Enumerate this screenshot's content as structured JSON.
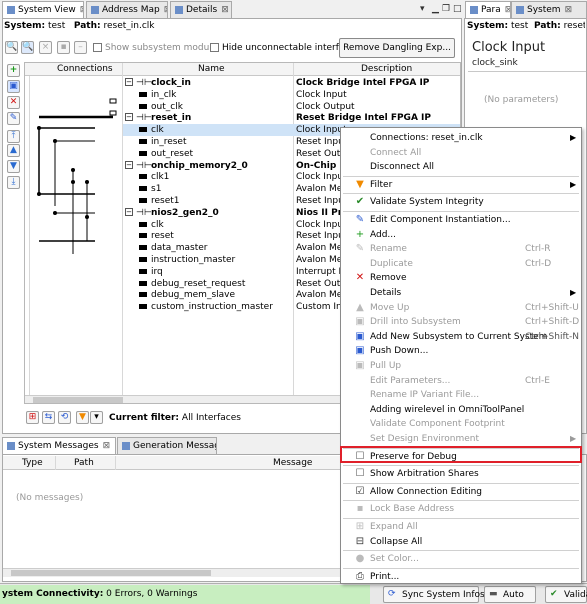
{
  "system_view": {
    "tabs": [
      {
        "label": "System View",
        "active": true
      },
      {
        "label": "Address Map",
        "active": false
      },
      {
        "label": "Details",
        "active": false
      }
    ],
    "system_label": "System:",
    "system_value": "test",
    "path_label": "Path:",
    "path_value": "reset_in.clk",
    "show_subsystem_label": "Show subsystem modu...",
    "hide_unconnectable_label": "Hide unconnectable interfa...",
    "remove_dangling_label": "Remove Dangling Exp...",
    "columns": [
      "Connections",
      "Name",
      "Description"
    ],
    "rows": [
      {
        "name": "clock_in",
        "desc": "Clock Bridge Intel FPGA IP",
        "bold": true,
        "level": 0
      },
      {
        "name": "in_clk",
        "desc": "Clock Input",
        "bold": false,
        "level": 1
      },
      {
        "name": "out_clk",
        "desc": "Clock Output",
        "bold": false,
        "level": 1
      },
      {
        "name": "reset_in",
        "desc": "Reset Bridge Intel FPGA IP",
        "bold": true,
        "level": 0
      },
      {
        "name": "clk",
        "desc": "Clock Input",
        "bold": false,
        "level": 1,
        "selected": true
      },
      {
        "name": "in_reset",
        "desc": "Reset Input",
        "bold": false,
        "level": 1
      },
      {
        "name": "out_reset",
        "desc": "Reset Output",
        "bold": false,
        "level": 1
      },
      {
        "name": "onchip_memory2_0",
        "desc": "On-Chip Me",
        "bold": true,
        "level": 0
      },
      {
        "name": "clk1",
        "desc": "Clock Input",
        "bold": false,
        "level": 1
      },
      {
        "name": "s1",
        "desc": "Avalon Mem",
        "bold": false,
        "level": 1
      },
      {
        "name": "reset1",
        "desc": "Reset Input",
        "bold": false,
        "level": 1
      },
      {
        "name": "nios2_gen2_0",
        "desc": "Nios II Pro",
        "bold": true,
        "level": 0
      },
      {
        "name": "clk",
        "desc": "Clock Input",
        "bold": false,
        "level": 1
      },
      {
        "name": "reset",
        "desc": "Reset Input",
        "bold": false,
        "level": 1
      },
      {
        "name": "data_master",
        "desc": "Avalon Mem",
        "bold": false,
        "level": 1
      },
      {
        "name": "instruction_master",
        "desc": "Avalon Mem",
        "bold": false,
        "level": 1
      },
      {
        "name": "irq",
        "desc": "Interrupt Re",
        "bold": false,
        "level": 1
      },
      {
        "name": "debug_reset_request",
        "desc": "Reset Outpu",
        "bold": false,
        "level": 1
      },
      {
        "name": "debug_mem_slave",
        "desc": "Avalon Mem",
        "bold": false,
        "level": 1
      },
      {
        "name": "custom_instruction_master",
        "desc": "Custom Inst",
        "bold": false,
        "level": 1
      }
    ],
    "filter_label": "Current filter:",
    "filter_value": "All Interfaces"
  },
  "params": {
    "tabs": [
      {
        "label": "Para",
        "active": true
      },
      {
        "label": "System",
        "active": false
      }
    ],
    "system_label": "System:",
    "system_value": "test",
    "path_label": "Path:",
    "path_value": "reset_",
    "title": "Clock Input",
    "subtitle": "clock_sink",
    "empty": "(No parameters)"
  },
  "messages": {
    "tabs": [
      {
        "label": "System Messages",
        "active": true
      },
      {
        "label": "Generation Messages",
        "active": false
      }
    ],
    "columns": [
      "Type",
      "Path",
      "Message"
    ],
    "empty": "(No messages)"
  },
  "context_menu": {
    "items": [
      {
        "label": "Connections: reset_in.clk",
        "arrow": true,
        "enabled": true,
        "icon": ""
      },
      {
        "label": "Connect All",
        "enabled": false,
        "icon": ""
      },
      {
        "label": "Disconnect All",
        "enabled": true,
        "icon": ""
      },
      {
        "sep": true
      },
      {
        "label": "Filter",
        "arrow": true,
        "enabled": true,
        "icon": "filter-icon"
      },
      {
        "sep": true
      },
      {
        "label": "Validate System Integrity",
        "enabled": true,
        "icon": "validate-icon"
      },
      {
        "sep": true
      },
      {
        "label": "Edit Component Instantiation...",
        "enabled": true,
        "icon": "edit-icon"
      },
      {
        "label": "Add...",
        "enabled": true,
        "icon": "add-icon"
      },
      {
        "label": "Rename",
        "shortcut": "Ctrl-R",
        "enabled": false,
        "icon": "rename-icon"
      },
      {
        "label": "Duplicate",
        "shortcut": "Ctrl-D",
        "enabled": false,
        "icon": ""
      },
      {
        "label": "Remove",
        "enabled": true,
        "icon": "remove-icon"
      },
      {
        "label": "Details",
        "arrow": true,
        "enabled": true,
        "icon": ""
      },
      {
        "label": "Move Up",
        "shortcut": "Ctrl+Shift-U",
        "enabled": false,
        "icon": "move-up-icon"
      },
      {
        "label": "Drill into Subsystem",
        "shortcut": "Ctrl+Shift-D",
        "enabled": false,
        "icon": "drill-icon"
      },
      {
        "label": "Add New Subsystem to Current System",
        "shortcut": "Ctrl+Shift-N",
        "enabled": true,
        "icon": "subsystem-icon"
      },
      {
        "label": "Push Down...",
        "enabled": true,
        "icon": "push-down-icon"
      },
      {
        "label": "Pull Up",
        "enabled": false,
        "icon": "pull-up-icon"
      },
      {
        "label": "Edit Parameters...",
        "shortcut": "Ctrl-E",
        "enabled": false,
        "icon": ""
      },
      {
        "label": "Rename IP Variant File...",
        "enabled": false,
        "icon": ""
      },
      {
        "label": "Adding wirelevel in OmniToolPanel",
        "enabled": true,
        "icon": ""
      },
      {
        "label": "Validate Component Footprint",
        "enabled": false,
        "icon": ""
      },
      {
        "label": "Set Design Environment",
        "arrow": true,
        "enabled": false,
        "icon": ""
      },
      {
        "sep": true
      },
      {
        "label": "Preserve for Debug",
        "enabled": true,
        "icon": "checkbox-icon",
        "highlighted": true
      },
      {
        "sep": true
      },
      {
        "label": "Show Arbitration Shares",
        "enabled": true,
        "icon": "checkbox-icon"
      },
      {
        "sep": true
      },
      {
        "label": "Allow Connection Editing",
        "enabled": true,
        "icon": "checkbox-checked-icon"
      },
      {
        "sep": true
      },
      {
        "label": "Lock Base Address",
        "enabled": false,
        "icon": "lock-icon"
      },
      {
        "sep": true
      },
      {
        "label": "Expand All",
        "enabled": false,
        "icon": "expand-icon"
      },
      {
        "label": "Collapse All",
        "enabled": true,
        "icon": "collapse-icon"
      },
      {
        "sep": true
      },
      {
        "label": "Set Color...",
        "enabled": false,
        "icon": "color-icon"
      },
      {
        "sep": true
      },
      {
        "label": "Print...",
        "enabled": true,
        "icon": "print-icon"
      }
    ]
  },
  "status_bar": {
    "connectivity_label": "ystem Connectivity:",
    "connectivity_value": "0 Errors, 0 Warnings",
    "sync_label": "Sync System Infos",
    "auto_label": "Auto",
    "valida_label": "Valida"
  },
  "colors": {
    "highlight_border": "#e0202a",
    "selected_row": "#cfe3f7",
    "status_green": "#c8eec0"
  }
}
